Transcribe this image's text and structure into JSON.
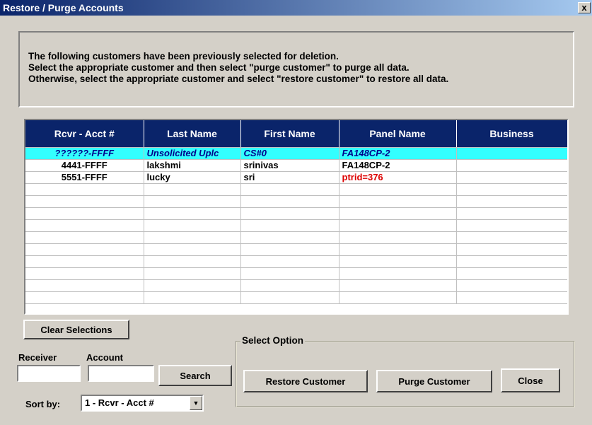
{
  "window": {
    "title": "Restore / Purge Accounts",
    "close_glyph": "x"
  },
  "info": {
    "line1": "The following customers have been previously selected for deletion.",
    "line2": "Select the appropriate customer and then select \"purge customer\" to purge all data.",
    "line3": "Otherwise, select the appropriate customer and select \"restore customer\" to restore all data."
  },
  "table": {
    "columns": [
      "Rcvr - Acct #",
      "Last Name",
      "First Name",
      "Panel Name",
      "Business"
    ],
    "rows": [
      [
        "??????-FFFF",
        "Unsolicited Uplc",
        "CS#0",
        "FA148CP-2",
        ""
      ],
      [
        "4441-FFFF",
        "lakshmi",
        "srinivas",
        "FA148CP-2",
        ""
      ],
      [
        "5551-FFFF",
        "lucky",
        "sri",
        "ptrid=376",
        ""
      ]
    ]
  },
  "buttons": {
    "clear_selections": "Clear Selections",
    "search": "Search",
    "restore_customer": "Restore Customer",
    "purge_customer": "Purge Customer",
    "close": "Close"
  },
  "fields": {
    "receiver_label": "Receiver",
    "account_label": "Account",
    "receiver_value": "",
    "account_value": "",
    "sort_label": "Sort by:",
    "sort_value": "1 - Rcvr - Acct #"
  },
  "group": {
    "label": "Select Option"
  },
  "colors": {
    "header_bg": "#0a246a",
    "selected_row": "#33ffff",
    "red_text": "#dd0000"
  }
}
